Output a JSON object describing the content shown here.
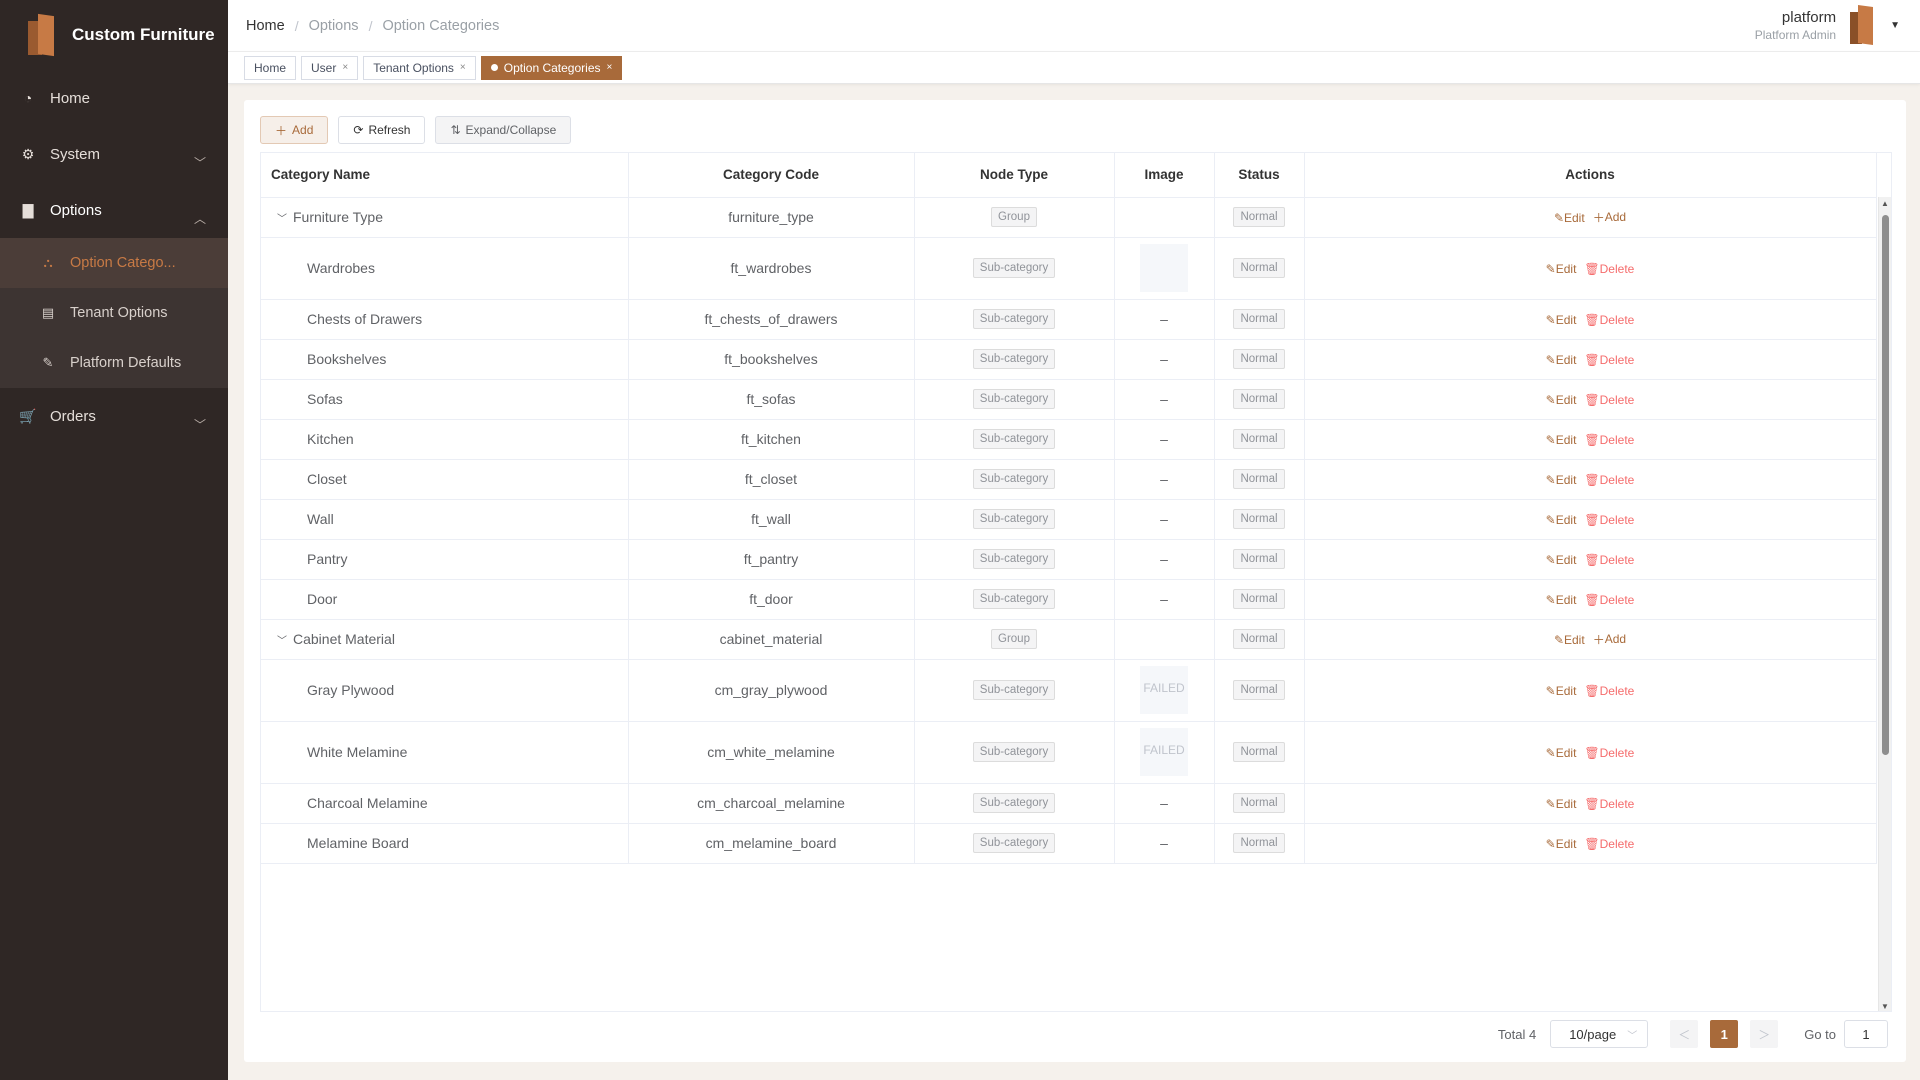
{
  "app": {
    "title": "Custom Furniture"
  },
  "sidebar": {
    "items": [
      {
        "label": "Home",
        "icon": "dashboard-icon"
      },
      {
        "label": "System",
        "icon": "gear-icon"
      },
      {
        "label": "Options",
        "icon": "folder-icon"
      },
      {
        "label": "Orders",
        "icon": "cart-icon"
      }
    ],
    "options_sub": [
      {
        "label": "Option Catego...",
        "icon": "tree-icon",
        "active": true
      },
      {
        "label": "Tenant Options",
        "icon": "list-icon"
      },
      {
        "label": "Platform Defaults",
        "icon": "edit-icon"
      }
    ]
  },
  "breadcrumb": [
    "Home",
    "Options",
    "Option Categories"
  ],
  "user": {
    "name": "platform",
    "role": "Platform Admin"
  },
  "tags": [
    {
      "label": "Home",
      "closable": false
    },
    {
      "label": "User",
      "closable": true
    },
    {
      "label": "Tenant Options",
      "closable": true
    },
    {
      "label": "Option Categories",
      "closable": true,
      "active": true
    }
  ],
  "toolbar": {
    "add": "Add",
    "refresh": "Refresh",
    "expand": "Expand/Collapse"
  },
  "table": {
    "headers": [
      "Category Name",
      "Category Code",
      "Node Type",
      "Image",
      "Status",
      "Actions"
    ],
    "rows": [
      {
        "name": "Furniture Type",
        "code": "furniture_type",
        "type": "Group",
        "image": "",
        "status": "Normal",
        "kind": "group"
      },
      {
        "name": "Wardrobes",
        "code": "ft_wardrobes",
        "type": "Sub-category",
        "image": "placeholder",
        "status": "Normal",
        "kind": "child"
      },
      {
        "name": "Chests of Drawers",
        "code": "ft_chests_of_drawers",
        "type": "Sub-category",
        "image": "–",
        "status": "Normal",
        "kind": "child"
      },
      {
        "name": "Bookshelves",
        "code": "ft_bookshelves",
        "type": "Sub-category",
        "image": "–",
        "status": "Normal",
        "kind": "child"
      },
      {
        "name": "Sofas",
        "code": "ft_sofas",
        "type": "Sub-category",
        "image": "–",
        "status": "Normal",
        "kind": "child"
      },
      {
        "name": "Kitchen",
        "code": "ft_kitchen",
        "type": "Sub-category",
        "image": "–",
        "status": "Normal",
        "kind": "child"
      },
      {
        "name": "Closet",
        "code": "ft_closet",
        "type": "Sub-category",
        "image": "–",
        "status": "Normal",
        "kind": "child"
      },
      {
        "name": "Wall",
        "code": "ft_wall",
        "type": "Sub-category",
        "image": "–",
        "status": "Normal",
        "kind": "child"
      },
      {
        "name": "Pantry",
        "code": "ft_pantry",
        "type": "Sub-category",
        "image": "–",
        "status": "Normal",
        "kind": "child"
      },
      {
        "name": "Door",
        "code": "ft_door",
        "type": "Sub-category",
        "image": "–",
        "status": "Normal",
        "kind": "child"
      },
      {
        "name": "Cabinet Material",
        "code": "cabinet_material",
        "type": "Group",
        "image": "",
        "status": "Normal",
        "kind": "group"
      },
      {
        "name": "Gray Plywood",
        "code": "cm_gray_plywood",
        "type": "Sub-category",
        "image": "FAILED",
        "status": "Normal",
        "kind": "child"
      },
      {
        "name": "White Melamine",
        "code": "cm_white_melamine",
        "type": "Sub-category",
        "image": "FAILED",
        "status": "Normal",
        "kind": "child"
      },
      {
        "name": "Charcoal Melamine",
        "code": "cm_charcoal_melamine",
        "type": "Sub-category",
        "image": "–",
        "status": "Normal",
        "kind": "child"
      },
      {
        "name": "Melamine Board",
        "code": "cm_melamine_board",
        "type": "Sub-category",
        "image": "–",
        "status": "Normal",
        "kind": "child"
      }
    ],
    "actions": {
      "edit": "Edit",
      "delete": "Delete",
      "add": "Add"
    }
  },
  "pager": {
    "total": "Total 4",
    "size": "10/page",
    "page": "1",
    "goto": "Go to",
    "goto_value": "1"
  },
  "colors": {
    "accent": "#a86a3a",
    "sidebar": "#2f2725",
    "danger": "#f56c6c"
  }
}
